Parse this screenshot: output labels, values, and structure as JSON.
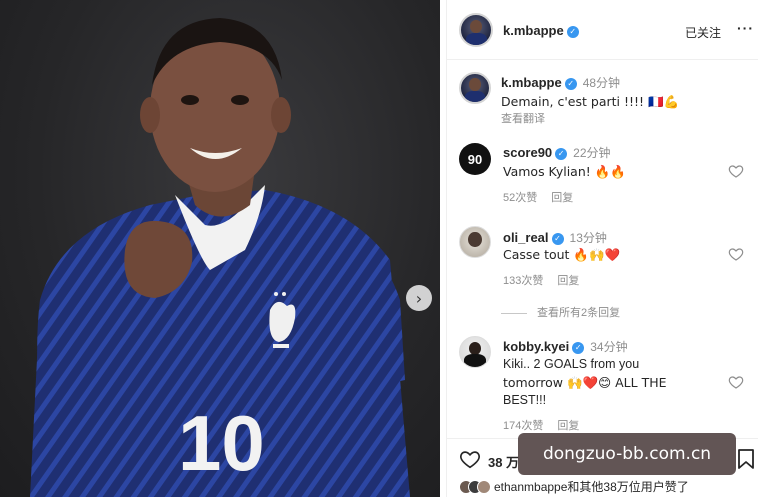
{
  "photo": {
    "jersey_number": "10",
    "next_icon": "chevron-right-icon"
  },
  "post_header": {
    "username": "k.mbappe",
    "follow_label": "已关注",
    "more_label": "···"
  },
  "caption": {
    "username": "k.mbappe",
    "time": "48分钟",
    "text": "Demain, c'est parti !!!! 🇫🇷💪",
    "translate_label": "查看翻译"
  },
  "comments": [
    {
      "username": "score90",
      "time": "22分钟",
      "text": "Vamos Kylian! 🔥🔥",
      "likes": "52次赞",
      "reply_label": "回复"
    },
    {
      "username": "oli_real",
      "time": "13分钟",
      "text": "Casse tout 🔥🙌❤️",
      "likes": "133次赞",
      "reply_label": "回复"
    },
    {
      "username": "kobby.kyei",
      "time": "34分钟",
      "text_line1": "Kiki.. 2 GOALS from you",
      "text_line2": "tomorrow 🙌❤️😊 ALL THE",
      "text_line3": "BEST!!!",
      "likes": "174次赞",
      "reply_label": "回复"
    }
  ],
  "view_replies_label": "查看所有2条回复",
  "footer": {
    "likes_partial": "38 万",
    "liked_by": "ethanmbappe和其他38万位用户赞了"
  },
  "watermark": "dongzuo-bb.com.cn",
  "colors": {
    "verified": "#3897f0",
    "jersey": "#1e2f6e",
    "secondary_text": "#8e8e8e"
  }
}
